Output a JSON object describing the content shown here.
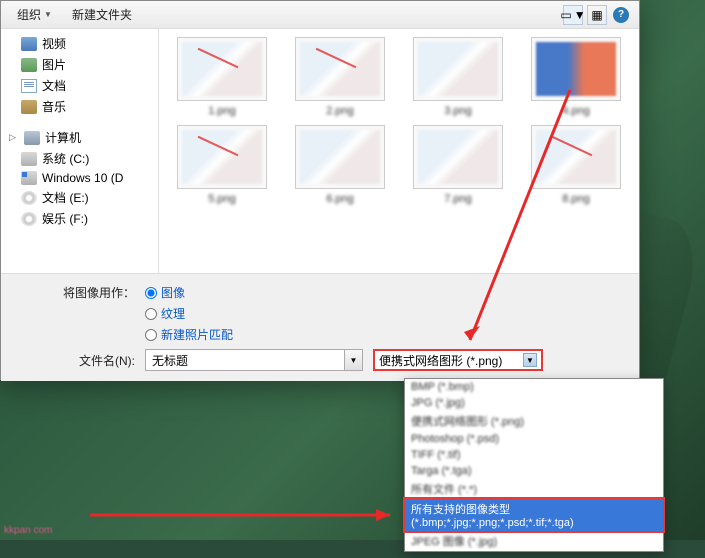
{
  "toolbar": {
    "organize": "组织",
    "newfolder": "新建文件夹"
  },
  "sidebar": {
    "video": "视频",
    "pictures": "图片",
    "documents": "文档",
    "music": "音乐",
    "computer": "计算机",
    "drive_c": "系统 (C:)",
    "drive_win": "Windows 10 (D",
    "drive_e": "文档 (E:)",
    "drive_f": "娱乐 (F:)"
  },
  "thumbs": [
    "1.png",
    "2.png",
    "3.png",
    "4.png",
    "5.png",
    "6.png",
    "7.png",
    "8.png"
  ],
  "use_as": {
    "label": "将图像用作：",
    "opt_image": "图像",
    "opt_texture": "纹理",
    "opt_match": "新建照片匹配"
  },
  "filename": {
    "label": "文件名(N):",
    "value": "无标题"
  },
  "filetype": {
    "selected": "便携式网络图形 (*.png)"
  },
  "dropdown": {
    "items": [
      "BMP (*.bmp)",
      "JPG (*.jpg)",
      "便携式网络图形 (*.png)",
      "Photoshop (*.psd)",
      "TIFF (*.tif)",
      "Targa (*.tga)",
      "所有文件 (*.*)"
    ],
    "highlighted": "所有支持的图像类型 (*.bmp;*.jpg;*.png;*.psd;*.tif;*.tga)",
    "last": "JPEG 图像 (*.jpg)"
  },
  "watermark": "kkpan com"
}
